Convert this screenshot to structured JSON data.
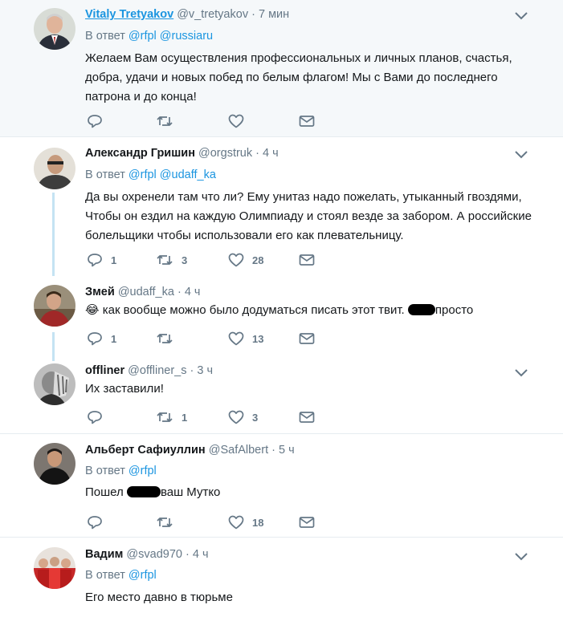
{
  "tweets": [
    {
      "name": "Vitaly Tretyakov",
      "handle": "@v_tretyakov",
      "dot": "·",
      "time": "7 мин",
      "reply_prefix": "В ответ",
      "mentions": [
        "@rfpl",
        "@russiaru"
      ],
      "text": "Желаем Вам осуществления профессиональных и личных планов, счастья, добра, удачи и новых побед по белым флагом! Мы с Вами до последнего патрона и до конца!",
      "replies": "",
      "retweets": "",
      "likes": ""
    },
    {
      "name": "Александр Гришин",
      "handle": "@orgstruk",
      "dot": "·",
      "time": "4 ч",
      "reply_prefix": "В ответ",
      "mentions": [
        "@rfpl",
        "@udaff_ka"
      ],
      "text": "Да вы охренели там что ли? Ему унитаз надо пожелать, утыканный гвоздями, Чтобы он ездил на каждую Олимпиаду и стоял везде за забором. А российские болельщики чтобы использовали его как плевательницу.",
      "replies": "1",
      "retweets": "3",
      "likes": "28"
    },
    {
      "name": "Змей",
      "handle": "@udaff_ka",
      "dot": "·",
      "time": "4 ч",
      "emoji": "😂",
      "text_before": "как вообще можно было додуматься писать этот твит.",
      "text_after": "просто",
      "replies": "1",
      "retweets": "",
      "likes": "13"
    },
    {
      "name": "offliner",
      "handle": "@offliner_s",
      "dot": "·",
      "time": "3 ч",
      "text": "Их заставили!",
      "replies": "",
      "retweets": "1",
      "likes": "3"
    },
    {
      "name": "Альберт Сафиуллин",
      "handle": "@SafAlbert",
      "dot": "·",
      "time": "5 ч",
      "reply_prefix": "В ответ",
      "mentions": [
        "@rfpl"
      ],
      "text_before": "Пошел",
      "text_after": "ваш Мутко",
      "replies": "",
      "retweets": "",
      "likes": "18"
    },
    {
      "name": "Вадим",
      "handle": "@svad970",
      "dot": "·",
      "time": "4 ч",
      "reply_prefix": "В ответ",
      "mentions": [
        "@rfpl"
      ],
      "text": "Его место давно в тюрьме"
    }
  ],
  "colors": {
    "highlight_bg": "#f5f8fa",
    "link": "#1b95e0",
    "muted": "#657786",
    "thread_line": "#c4e3f3"
  },
  "icons": [
    "reply-icon",
    "retweet-icon",
    "like-icon",
    "dm-icon",
    "chevron-down-icon"
  ]
}
